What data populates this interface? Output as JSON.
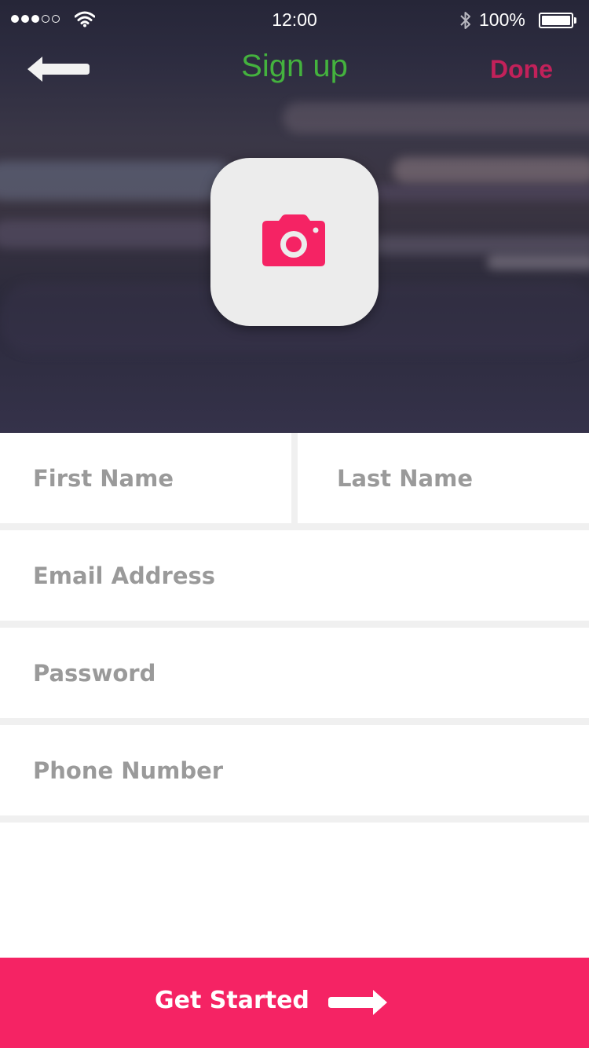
{
  "status_bar": {
    "time": "12:00",
    "battery_percent": "100%",
    "signal_bars_filled": 3,
    "signal_bars_total": 5,
    "battery_level": 1.0
  },
  "nav": {
    "back_icon": "arrow-left-icon",
    "title": "Sign up",
    "done_label": "Done",
    "title_color": "#44b23e",
    "done_color": "#c2215a"
  },
  "avatar": {
    "icon": "camera-icon",
    "icon_color": "#f52364"
  },
  "form": {
    "first_name_placeholder": "First Name",
    "last_name_placeholder": "Last Name",
    "email_placeholder": "Email Address",
    "password_placeholder": "Password",
    "phone_placeholder": "Phone Number"
  },
  "footer": {
    "cta_label": "Get Started",
    "cta_icon": "arrow-right-icon",
    "cta_color": "#f52364"
  }
}
